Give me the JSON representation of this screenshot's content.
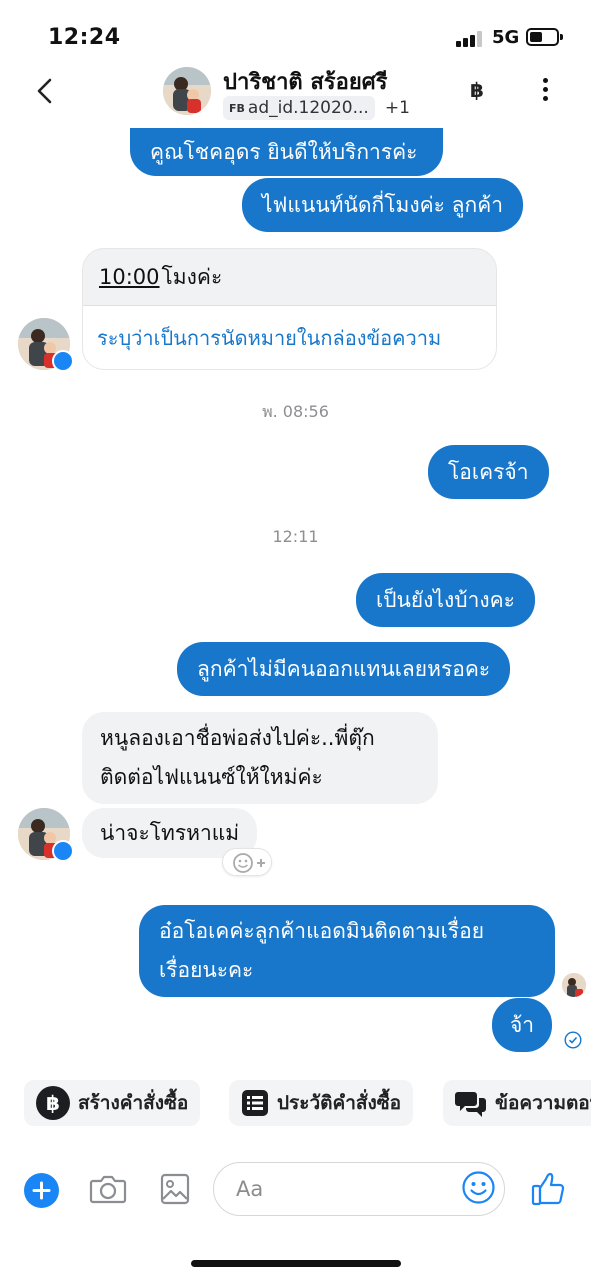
{
  "status_bar": {
    "time": "12:24",
    "network": "5G"
  },
  "header": {
    "contact_name": "ปาริชาติ สร้อยศรี",
    "ad_prefix": "FB",
    "ad_id": "ad_id.12020...",
    "extra_count": "+1",
    "currency_symbol": "฿"
  },
  "messages": {
    "m1": "คูณโชคอุดร ยินดีให้บริการค่ะ",
    "m2": "ไฟแนนท์นัดกี่โมงค่ะ ลูกค้า",
    "card_time": "10:00",
    "card_suffix": "โมงค่ะ",
    "card_action": "ระบุว่าเป็นการนัดหมายในกล่องข้อความ",
    "ts1": "พ. 08:56",
    "m3": "โอเครจ้า",
    "ts2": "12:11",
    "m4": "เป็นยังไงบ้างคะ",
    "m5": "ลูกค้าไม่มีคนออกแทนเลยหรอคะ",
    "m6_line1": "หนูลองเอาชื่อพ่อส่งไปค่ะ..พี่ตุ๊ก",
    "m6_line2": "ติดต่อไฟแนนซ์ให้ใหม่ค่ะ",
    "m7": "น่าจะโทรหาแม่",
    "m8_line1": "อ๋อโอเคค่ะลูกค้าแอดมินติดตามเรื่อย",
    "m8_line2": "เรื่อยนะคะ",
    "m9": "จ้า"
  },
  "quick_actions": {
    "create_order": "สร้างคำสั่งซื้อ",
    "order_history": "ประวัติคำสั่งซื้อ",
    "saved_replies": "ข้อความตอบกลับ"
  },
  "composer": {
    "placeholder": "Aa"
  },
  "colors": {
    "accent": "#1877cb",
    "incoming_bg": "#f1f2f4",
    "timestamp": "#8e8e93"
  }
}
